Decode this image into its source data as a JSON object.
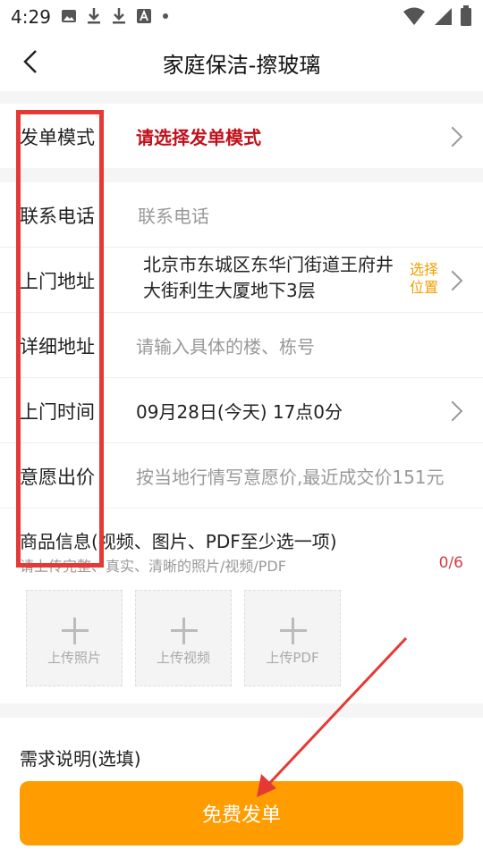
{
  "status": {
    "time": "4:29"
  },
  "nav": {
    "title": "家庭保洁-擦玻璃"
  },
  "form": {
    "mode": {
      "label": "发单模式",
      "value": "请选择发单模式"
    },
    "phone": {
      "label": "联系电话",
      "placeholder": "联系电话"
    },
    "address": {
      "label": "上门地址",
      "line1": "北京市东城区东华门街道王府井",
      "line2": "大街利生大厦地下3层",
      "select1": "选择",
      "select2": "位置"
    },
    "detail": {
      "label": "详细地址",
      "placeholder": "请输入具体的楼、栋号"
    },
    "time": {
      "label": "上门时间",
      "value": "09月28日(今天) 17点0分"
    },
    "price": {
      "label": "意愿出价",
      "placeholder": "按当地行情写意愿价,最近成交价151元"
    },
    "goods": {
      "label": "商品信息(视频、图片、PDF至少选一项)",
      "hint": "请上传完整、真实、清晰的照片/视频/PDF",
      "count": "0/6"
    },
    "uploads": [
      {
        "label": "上传照片"
      },
      {
        "label": "上传视频"
      },
      {
        "label": "上传PDF"
      }
    ],
    "demand": {
      "label": "需求说明(选填)"
    }
  },
  "submit": {
    "label": "免费发单"
  },
  "colors": {
    "accent": "#ff9c00",
    "mode_value": "#c0101a",
    "annotation": "#e53935",
    "select_position": "#f0a000",
    "count": "#d04040"
  }
}
